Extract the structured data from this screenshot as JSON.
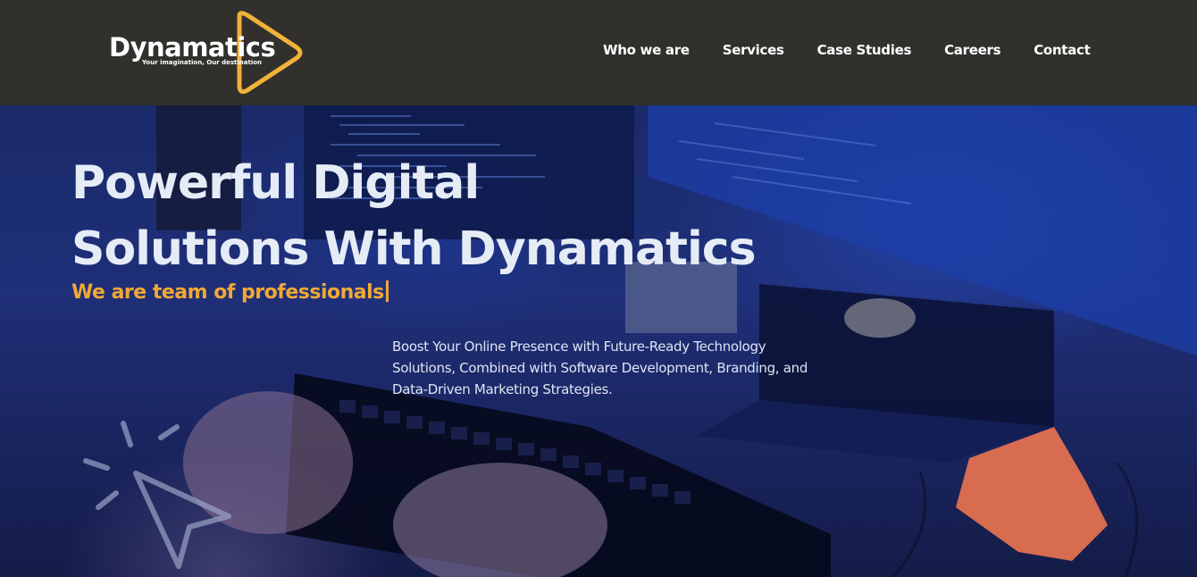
{
  "brand": {
    "name": "Dynamatics",
    "tagline": "Your imagination, Our destination",
    "accent_color": "#f0b23a"
  },
  "nav": {
    "items": [
      {
        "label": "Who we are"
      },
      {
        "label": "Services"
      },
      {
        "label": "Case Studies"
      },
      {
        "label": "Careers"
      },
      {
        "label": "Contact"
      }
    ]
  },
  "hero": {
    "title_line1": "Powerful Digital",
    "title_line2": "Solutions With Dynamatics",
    "subtitle": "We are team of professionals",
    "description": "Boost Your Online Presence with Future-Ready Technology Solutions, Combined with Software Development, Branding, and Data-Driven Marketing Strategies.",
    "subtitle_color": "#f0a935",
    "decor_icon": "cursor-click-icon"
  }
}
